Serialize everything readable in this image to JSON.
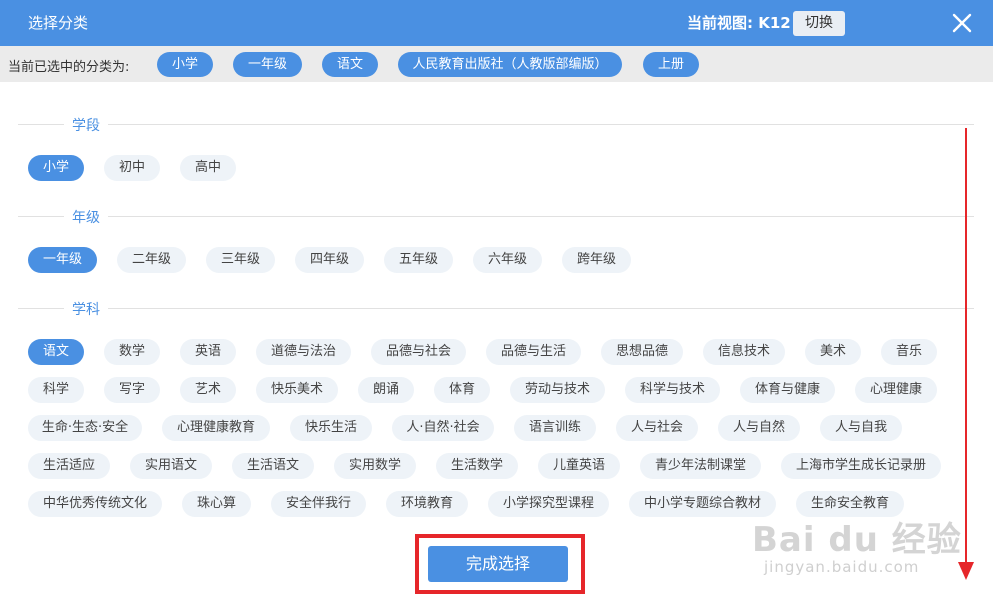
{
  "header": {
    "title": "选择分类",
    "view_label": "当前视图: K12",
    "switch_label": "切换"
  },
  "selected": {
    "label": "当前已选中的分类为:",
    "tags": [
      "小学",
      "一年级",
      "语文",
      "人民教育出版社（人教版部编版）",
      "上册"
    ]
  },
  "sections": {
    "stage": {
      "title": "学段",
      "options": [
        "小学",
        "初中",
        "高中"
      ],
      "active": "小学"
    },
    "grade": {
      "title": "年级",
      "options": [
        "一年级",
        "二年级",
        "三年级",
        "四年级",
        "五年级",
        "六年级",
        "跨年级"
      ],
      "active": "一年级"
    },
    "subject": {
      "title": "学科",
      "options": [
        "语文",
        "数学",
        "英语",
        "道德与法治",
        "品德与社会",
        "品德与生活",
        "思想品德",
        "信息技术",
        "美术",
        "音乐",
        "科学",
        "写字",
        "艺术",
        "快乐美术",
        "朗诵",
        "体育",
        "劳动与技术",
        "科学与技术",
        "体育与健康",
        "心理健康",
        "生命·生态·安全",
        "心理健康教育",
        "快乐生活",
        "人·自然·社会",
        "语言训练",
        "人与社会",
        "人与自然",
        "人与自我",
        "生活适应",
        "实用语文",
        "生活语文",
        "实用数学",
        "生活数学",
        "儿童英语",
        "青少年法制课堂",
        "上海市学生成长记录册",
        "中华优秀传统文化",
        "珠心算",
        "安全伴我行",
        "环境教育",
        "小学探究型课程",
        "中小学专题综合教材",
        "生命安全教育"
      ],
      "active": "语文"
    }
  },
  "footer": {
    "done_label": "完成选择"
  },
  "watermark": {
    "text": "Bai du 经验",
    "sub": "jingyan.baidu.com"
  },
  "colors": {
    "primary": "#4a90e2",
    "tag_bg": "#eef3f8",
    "highlight": "#e6262a"
  }
}
